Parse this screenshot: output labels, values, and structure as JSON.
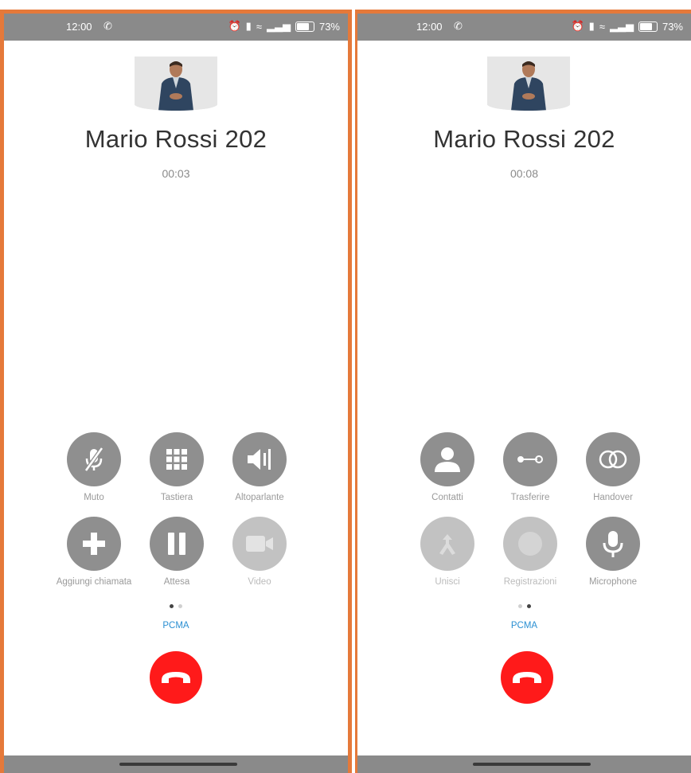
{
  "status_bar": {
    "time": "12:00",
    "battery": "73%"
  },
  "screens": [
    {
      "caller": {
        "name": "Mario Rossi 202",
        "timer": "00:03"
      },
      "buttons": [
        {
          "label": "Muto"
        },
        {
          "label": "Tastiera"
        },
        {
          "label": "Altoparlante"
        },
        {
          "label": "Aggiungi chiamata"
        },
        {
          "label": "Attesa"
        },
        {
          "label": "Video"
        }
      ],
      "codec": "PCMA",
      "page_index": 0
    },
    {
      "caller": {
        "name": "Mario Rossi 202",
        "timer": "00:08"
      },
      "buttons": [
        {
          "label": "Contatti"
        },
        {
          "label": "Trasferire"
        },
        {
          "label": "Handover"
        },
        {
          "label": "Unisci"
        },
        {
          "label": "Registrazioni"
        },
        {
          "label": "Microphone"
        }
      ],
      "codec": "PCMA",
      "page_index": 1
    }
  ],
  "colors": {
    "accent_border": "#e5793a",
    "button_gray": "#8f8f8f",
    "button_disabled": "#c2c2c2",
    "hangup_red": "#ff1a1a",
    "codec_blue": "#2a8fd2"
  }
}
